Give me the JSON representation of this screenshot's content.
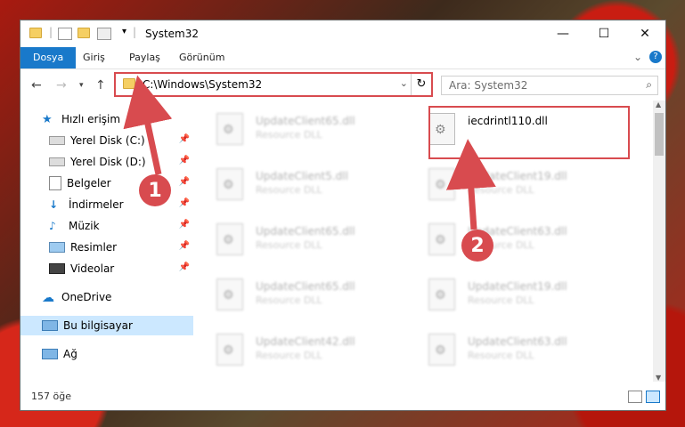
{
  "window": {
    "title": "System32",
    "buttons": {
      "minimize": "—",
      "maximize": "☐",
      "close": "✕"
    }
  },
  "ribbon": {
    "tabs": [
      "Dosya",
      "Giriş",
      "Paylaş",
      "Görünüm"
    ],
    "expand_icon": "chevron-down-icon",
    "help_icon": "help-icon"
  },
  "address": {
    "path": "C:\\Windows\\System32",
    "search_placeholder": "Ara: System32"
  },
  "sidebar": {
    "quick_access": "Hızlı erişim",
    "items": [
      "Yerel Disk (C:)",
      "Yerel Disk (D:)",
      "Belgeler",
      "İndirmeler",
      "Müzik",
      "Resimler",
      "Videolar"
    ],
    "onedrive": "OneDrive",
    "thispc": "Bu bilgisayar",
    "network": "Ağ"
  },
  "files": [
    {
      "name": "UpdateClient65.dll",
      "type": "Resource DLL"
    },
    {
      "name": "iecdrintl110.dll",
      "type": ""
    },
    {
      "name": "UpdateClient5.dll",
      "type": "Resource DLL"
    },
    {
      "name": "UpdateClient19.dll",
      "type": "Resource DLL"
    },
    {
      "name": "UpdateClient65.dll",
      "type": "Resource DLL"
    },
    {
      "name": "UpdateClient63.dll",
      "type": "Resource DLL"
    },
    {
      "name": "UpdateClient65.dll",
      "type": "Resource DLL"
    },
    {
      "name": "UpdateClient19.dll",
      "type": "Resource DLL"
    },
    {
      "name": "UpdateClient42.dll",
      "type": "Resource DLL"
    },
    {
      "name": "UpdateClient63.dll",
      "type": "Resource DLL"
    }
  ],
  "status": {
    "count": "157 öğe"
  },
  "callouts": [
    "1",
    "2"
  ],
  "colors": {
    "accent": "#1979ca",
    "highlight": "#d84b4f"
  }
}
